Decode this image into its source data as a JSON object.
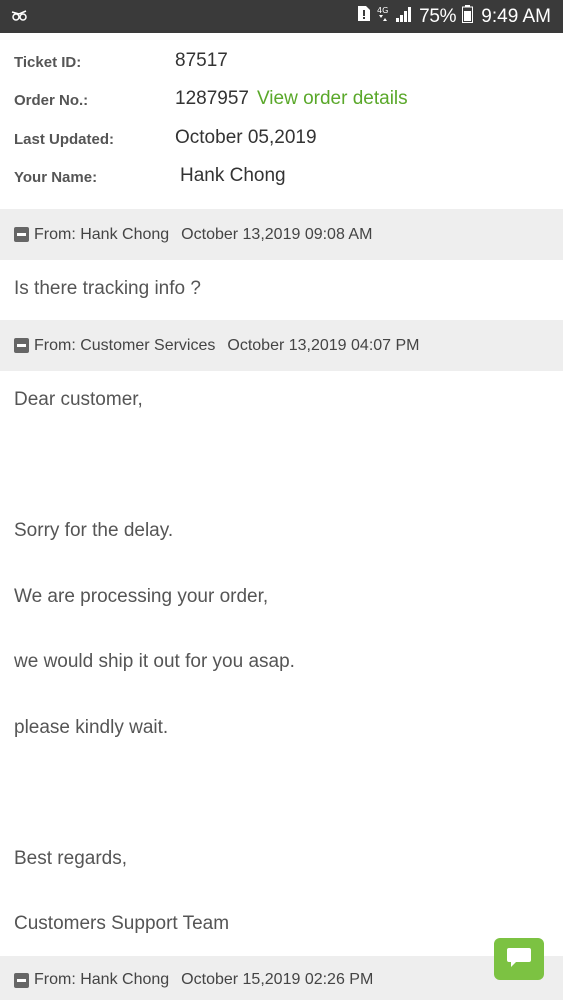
{
  "status_bar": {
    "battery": "75%",
    "time": "9:49 AM",
    "left_icon": "app-notification-icon",
    "right_icons": [
      "sim-alert-icon",
      "data-4g-icon",
      "signal-icon",
      "battery-icon"
    ]
  },
  "ticket": {
    "id_label": "Ticket ID:",
    "id_value": "87517",
    "order_label": "Order No.:",
    "order_value": "1287957",
    "order_link": "View order details",
    "updated_label": "Last Updated:",
    "updated_value": "October 05,2019",
    "name_label": "Your Name:",
    "name_value": "Hank Chong"
  },
  "messages": [
    {
      "from": "From: Hank Chong",
      "date": "October 13,2019 09:08 AM",
      "lines": [
        "Is there tracking info ?"
      ]
    },
    {
      "from": "From: Customer Services",
      "date": "October 13,2019 04:07 PM",
      "lines": [
        "Dear customer,",
        "Sorry for the delay.",
        "We are processing your order,",
        "we would ship it out for you asap.",
        "please kindly wait.",
        "Best regards,",
        "Customers Support Team"
      ]
    },
    {
      "from": "From: Hank Chong",
      "date": "October 15,2019 02:26 PM",
      "lines": []
    }
  ],
  "colors": {
    "link": "#5aa82a",
    "header_bg": "#eeeeee",
    "chat_button": "#7cc242",
    "status_bar": "#3a3a3a"
  },
  "chat_button_icon": "chat-bubble-icon"
}
